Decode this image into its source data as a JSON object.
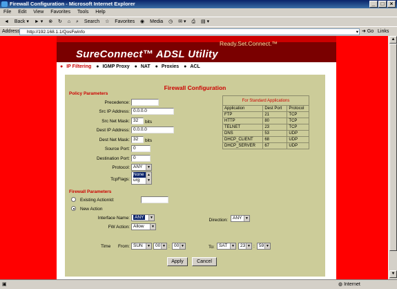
{
  "window": {
    "title": "Firewall Configuration - Microsoft Internet Explorer"
  },
  "menu": [
    "File",
    "Edit",
    "View",
    "Favorites",
    "Tools",
    "Help"
  ],
  "toolbar": {
    "back": "Back",
    "search": "Search",
    "favorites": "Favorites",
    "media": "Media"
  },
  "address": {
    "label": "Address",
    "url": "http://192.168.1.1/QosFwInfo",
    "go": "Go",
    "links": "Links"
  },
  "banner": {
    "logo": "SureConnect™ ADSL Utility",
    "tagline": "Ready.Set.Connect.™"
  },
  "tabs": [
    {
      "label": "IP Filtering",
      "active": true
    },
    {
      "label": "IGMP Proxy",
      "active": false
    },
    {
      "label": "NAT",
      "active": false
    },
    {
      "label": "Proxies",
      "active": false
    },
    {
      "label": "ACL",
      "active": false
    }
  ],
  "page_title": "Firewall Configuration",
  "policy": {
    "heading": "Policy Parameters",
    "precedence": {
      "label": "Precedence:",
      "value": ""
    },
    "src_ip": {
      "label": "Src IP Address:",
      "value": "0.0.0.0"
    },
    "src_mask": {
      "label": "Src Net Mask:",
      "value": "32",
      "unit": "bits"
    },
    "dest_ip": {
      "label": "Dest IP Address:",
      "value": "0.0.0.0"
    },
    "dest_mask": {
      "label": "Dest Net Mask:",
      "value": "32",
      "unit": "bits"
    },
    "src_port": {
      "label": "Source Port:",
      "value": "0"
    },
    "dest_port": {
      "label": "Destination Port:",
      "value": "0"
    },
    "protocol": {
      "label": "Protocol:",
      "value": "ANY"
    },
    "tcpflags": {
      "label": "TcpFlags:",
      "options": [
        "None",
        "urg"
      ],
      "selected": "None"
    }
  },
  "std_apps": {
    "caption": "For Standard Applications",
    "headers": [
      "Application",
      "Dest Port",
      "Protocol"
    ],
    "rows": [
      [
        "FTP",
        "21",
        "TCP"
      ],
      [
        "HTTP",
        "80",
        "TCP"
      ],
      [
        "TELNET",
        "23",
        "TCP"
      ],
      [
        "DNS",
        "53",
        "UDP"
      ],
      [
        "DHCP_CLIENT",
        "68",
        "UDP"
      ],
      [
        "DHCP_SERVER",
        "67",
        "UDP"
      ]
    ]
  },
  "firewall": {
    "heading": "Firewall Parameters",
    "existing": {
      "label": "Existing ActionId:",
      "value": ""
    },
    "new_action": {
      "label": "New Action"
    },
    "interface": {
      "label": "Interface Name:",
      "value": "ANY"
    },
    "direction": {
      "label": "Direction:",
      "value": "ANY"
    },
    "fw_action": {
      "label": "FW Action:",
      "value": "Allow"
    },
    "time": {
      "label": "Time",
      "from_label": "From:",
      "from_day": "SUN",
      "from_h": "00",
      "from_m": "00",
      "to_label": "To:",
      "to_day": "SAT",
      "to_h": "23",
      "to_m": "59"
    }
  },
  "buttons": {
    "apply": "Apply",
    "cancel": "Cancel"
  },
  "status": {
    "zone": "Internet"
  }
}
